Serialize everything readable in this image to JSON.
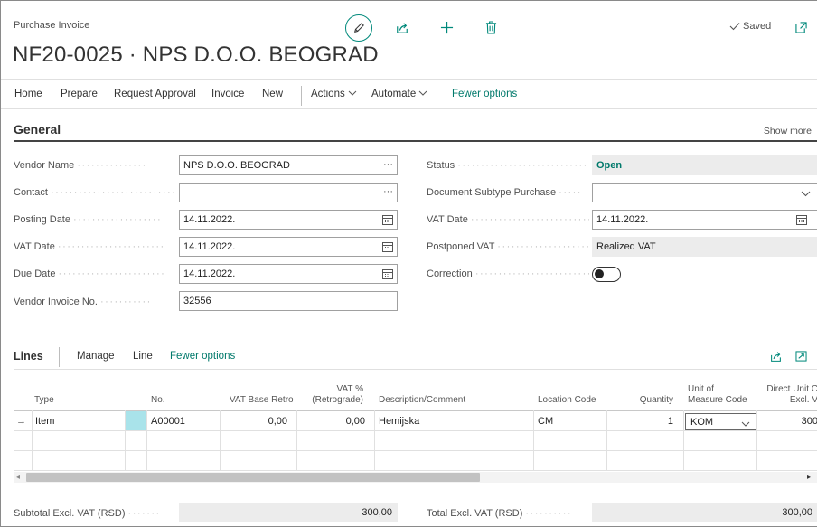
{
  "header": {
    "caption": "Purchase Invoice",
    "title": "NF20-0025 · NPS D.O.O. BEOGRAD",
    "saved_label": "Saved"
  },
  "actions": {
    "home": "Home",
    "prepare": "Prepare",
    "request_approval": "Request Approval",
    "invoice": "Invoice",
    "new": "New",
    "actions": "Actions",
    "automate": "Automate",
    "fewer_options": "Fewer options"
  },
  "general": {
    "title": "General",
    "show_more": "Show more",
    "left": [
      {
        "label": "Vendor Name",
        "value": "NPS D.O.O. BEOGRAD",
        "kind": "lookup"
      },
      {
        "label": "Contact",
        "value": "",
        "kind": "lookup"
      },
      {
        "label": "Posting Date",
        "value": "14.11.2022.",
        "kind": "date"
      },
      {
        "label": "VAT Date",
        "value": "14.11.2022.",
        "kind": "date"
      },
      {
        "label": "Due Date",
        "value": "14.11.2022.",
        "kind": "date"
      },
      {
        "label": "Vendor Invoice No.",
        "value": "32556",
        "kind": "text"
      }
    ],
    "right": [
      {
        "label": "Status",
        "value": "Open",
        "kind": "readonly"
      },
      {
        "label": "Document Subtype Purchase",
        "value": "",
        "kind": "select"
      },
      {
        "label": "VAT Date",
        "value": "14.11.2022.",
        "kind": "date"
      },
      {
        "label": "Postponed VAT",
        "value": "Realized VAT",
        "kind": "readonly"
      },
      {
        "label": "Correction",
        "value": "off",
        "kind": "toggle"
      }
    ]
  },
  "lines": {
    "title": "Lines",
    "menu": [
      "Manage",
      "Line",
      "Fewer options"
    ],
    "columns": {
      "type": "Type",
      "no": "No.",
      "vat_base_retro": "VAT Base Retro",
      "vat_pct_l1": "VAT %",
      "vat_pct_l2": "(Retrograde)",
      "description": "Description/Comment",
      "location": "Location Code",
      "quantity": "Quantity",
      "uom_l1": "Unit of",
      "uom_l2": "Measure Code",
      "direct_l1": "Direct Unit C",
      "direct_l2": "Excl. V"
    },
    "rows": [
      {
        "arrow": "→",
        "type": "Item",
        "no": "A00001",
        "vat_base_retro": "0,00",
        "vat_pct": "0,00",
        "description": "Hemijska",
        "location": "CM",
        "quantity": "1",
        "uom": "KOM",
        "direct": "300"
      }
    ]
  },
  "totals": {
    "subtotal_label": "Subtotal Excl. VAT (RSD)",
    "subtotal_value": "300,00",
    "total_label": "Total Excl. VAT (RSD)",
    "total_value": "300,00"
  },
  "colors": {
    "accent": "#00897b",
    "status_open": "#00796b"
  }
}
